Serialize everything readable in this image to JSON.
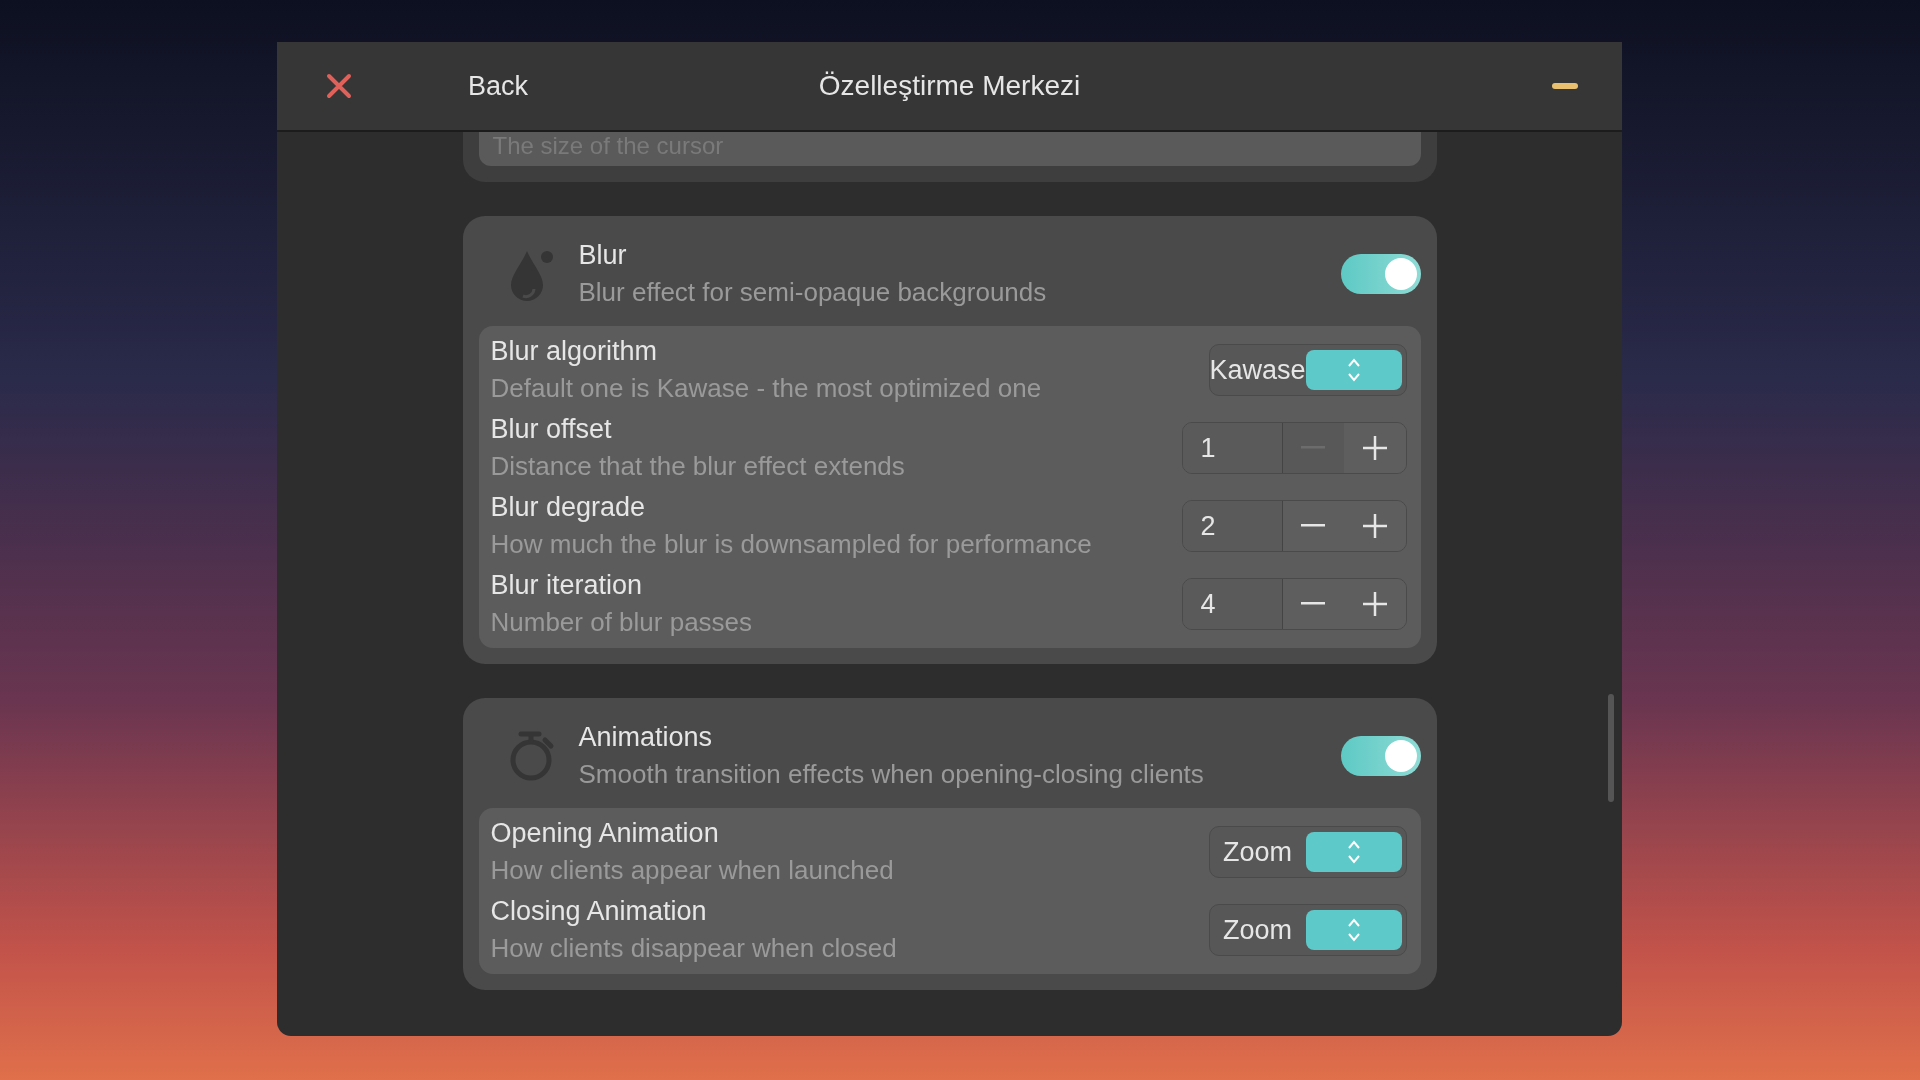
{
  "window": {
    "title": "Özelleştirme Merkezi",
    "back": "Back"
  },
  "partial_card": {
    "description": "The size of the cursor"
  },
  "sections": [
    {
      "kind": "blur",
      "title": "Blur",
      "description": "Blur effect for semi-opaque backgrounds",
      "enabled": true,
      "settings": [
        {
          "kind": "select",
          "label": "Blur algorithm",
          "description": "Default one is Kawase - the most optimized one",
          "value": "Kawase"
        },
        {
          "kind": "stepper",
          "label": "Blur offset",
          "description": "Distance that the blur effect extends",
          "value": "1",
          "minus_disabled": true
        },
        {
          "kind": "stepper",
          "label": "Blur degrade",
          "description": "How much the blur is downsampled for performance",
          "value": "2",
          "minus_disabled": false
        },
        {
          "kind": "stepper",
          "label": "Blur iteration",
          "description": "Number of blur passes",
          "value": "4",
          "minus_disabled": false
        }
      ]
    },
    {
      "kind": "animations",
      "title": "Animations",
      "description": "Smooth transition effects when opening-closing clients",
      "enabled": true,
      "settings": [
        {
          "kind": "select",
          "label": "Opening Animation",
          "description": "How clients appear when launched",
          "value": "Zoom"
        },
        {
          "kind": "select",
          "label": "Closing Animation",
          "description": "How clients disappear when closed",
          "value": "Zoom"
        }
      ]
    }
  ]
}
